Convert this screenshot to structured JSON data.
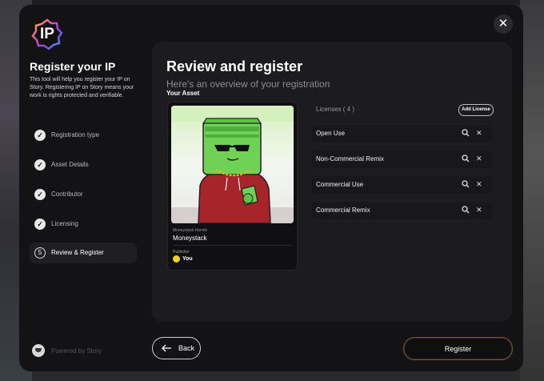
{
  "modal": {
    "logo_text": "IP",
    "close_glyph": "✕"
  },
  "sidebar": {
    "title": "Register your IP",
    "description": "This tool will help you register your IP on Story. Registering IP on Story means your work is rights protected and verifiable.",
    "steps": [
      {
        "label": "Registration type",
        "state": "done",
        "marker": "✓"
      },
      {
        "label": "Asset Details",
        "state": "done",
        "marker": "✓"
      },
      {
        "label": "Contributor",
        "state": "done",
        "marker": "✓"
      },
      {
        "label": "Licensing",
        "state": "done",
        "marker": "✓"
      },
      {
        "label": "Review & Register",
        "state": "active",
        "marker": "5"
      }
    ],
    "powered_by": "Powered by Story"
  },
  "main": {
    "title": "Review and register",
    "subtitle": "Here's an overview of your registration",
    "asset_heading": "Your Asset",
    "asset": {
      "collection": "Moneystack friends",
      "name": "Moneystack",
      "publisher_label": "Publisher",
      "publisher": "You"
    },
    "licenses_label": "Licenses ( 4 )",
    "add_license_label": "Add License",
    "licenses": [
      {
        "name": "Open Use"
      },
      {
        "name": "Non-Commercial Remix"
      },
      {
        "name": "Commercial Use"
      },
      {
        "name": "Commercial Remix"
      }
    ],
    "remove_glyph": "✕"
  },
  "footer": {
    "back_label": "Back",
    "register_label": "Register"
  },
  "colors": {
    "modal_bg": "#131315",
    "panel_bg": "#1c1c1e",
    "publisher_dot": "#f2d21b",
    "register_border": "#6b5d1b",
    "character_green": "#5cc44a",
    "character_hoodie": "#a8242b"
  }
}
